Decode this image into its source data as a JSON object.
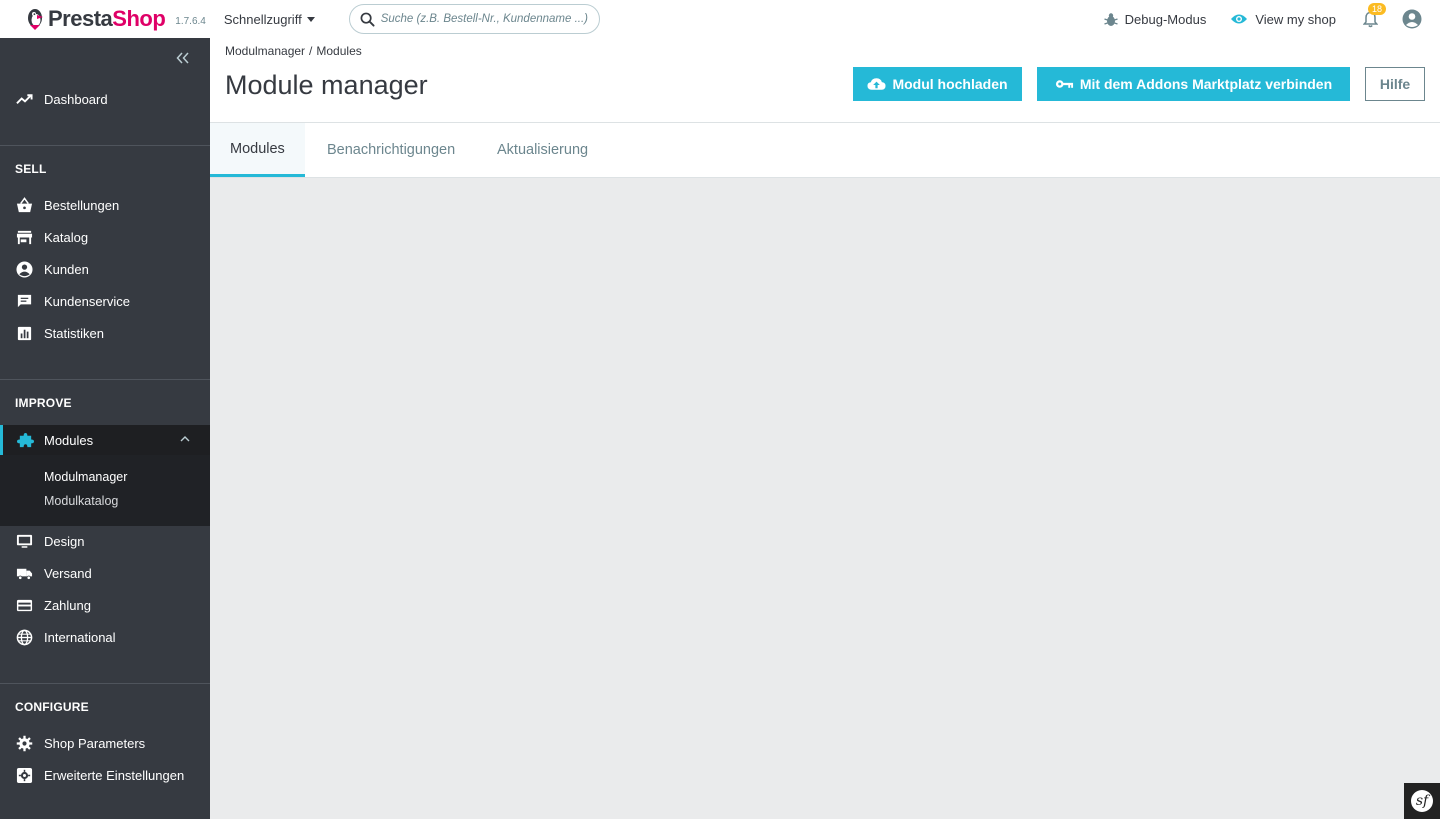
{
  "header": {
    "logo_left": "Presta",
    "logo_right": "Shop",
    "version": "1.7.6.4",
    "quick_access": "Schnellzugriff",
    "search_placeholder": "Suche (z.B. Bestell-Nr., Kundenname ...)",
    "debug_mode": "Debug-Modus",
    "view_shop": "View my shop",
    "notifications_count": "18"
  },
  "sidebar": {
    "dashboard": "Dashboard",
    "sell_title": "SELL",
    "sell_items": [
      "Bestellungen",
      "Katalog",
      "Kunden",
      "Kundenservice",
      "Statistiken"
    ],
    "improve_title": "IMPROVE",
    "modules": "Modules",
    "modules_sub": [
      "Modulmanager",
      "Modulkatalog"
    ],
    "improve_items": [
      "Design",
      "Versand",
      "Zahlung",
      "International"
    ],
    "configure_title": "CONFIGURE",
    "configure_items": [
      "Shop Parameters",
      "Erweiterte Einstellungen"
    ]
  },
  "page": {
    "breadcrumb": [
      "Modulmanager",
      "Modules"
    ],
    "breadcrumb_sep": "/",
    "title": "Module manager",
    "btn_upload": "Modul hochladen",
    "btn_connect": "Mit dem Addons Marktplatz verbinden",
    "btn_help": "Hilfe"
  },
  "tabs": [
    "Modules",
    "Benachrichtigungen",
    "Aktualisierung"
  ],
  "symfony_badge": "sf",
  "colors": {
    "accent": "#25b9d7",
    "sidebar": "#363a41",
    "brand_pink": "#df0067",
    "badge": "#fbbb22"
  }
}
